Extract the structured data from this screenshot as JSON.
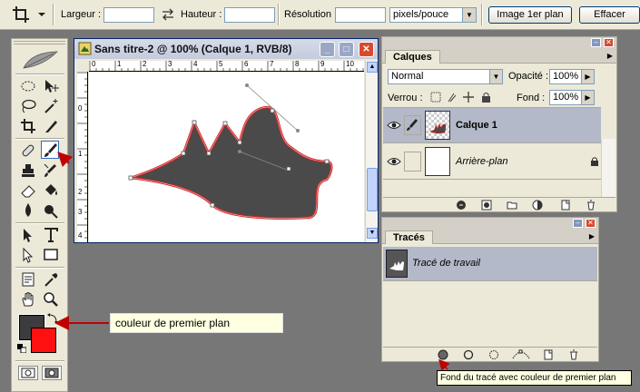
{
  "options_bar": {
    "width_label": "Largeur :",
    "width_value": "",
    "height_label": "Hauteur :",
    "height_value": "",
    "resolution_label": "Résolution :",
    "resolution_value": "",
    "resolution_unit": "pixels/pouce",
    "front_image_button": "Image 1er plan",
    "clear_button": "Effacer"
  },
  "document": {
    "title": "Sans titre-2 @ 100% (Calque 1, RVB/8)",
    "ruler_h": [
      "0",
      "1",
      "2",
      "3",
      "4",
      "5",
      "6",
      "7",
      "8",
      "9",
      "10"
    ],
    "ruler_v": [
      "0",
      "1",
      "2",
      "3",
      "4"
    ]
  },
  "layers_panel": {
    "tab": "Calques",
    "blend_mode": "Normal",
    "opacity_label": "Opacité :",
    "opacity_value": "100%",
    "lock_label": "Verrou :",
    "fill_label": "Fond :",
    "fill_value": "100%",
    "layers": [
      {
        "name": "Calque 1",
        "selected": true
      },
      {
        "name": "Arrière-plan",
        "selected": false
      }
    ]
  },
  "paths_panel": {
    "tab": "Tracés",
    "paths": [
      {
        "name": "Tracé de travail",
        "selected": true
      }
    ]
  },
  "annotations": {
    "foreground_color": "couleur de premier plan",
    "fill_path_tooltip": "Fond du tracé avec couleur de premier plan"
  },
  "colors": {
    "foreground": "#3c3c3c",
    "background": "#ff1010",
    "shape_fill": "#4a4a4a",
    "path_stroke": "#e31b1b",
    "arrow": "#c00000"
  },
  "icons": [
    "crop-icon",
    "swap-arrows-icon",
    "feather-icon",
    "marquee-icon",
    "move-icon",
    "lasso-icon",
    "magic-wand-icon",
    "crop-tool-icon",
    "slice-icon",
    "healing-icon",
    "brush-icon",
    "stamp-icon",
    "history-brush-icon",
    "eraser-icon",
    "bucket-icon",
    "blur-icon",
    "dodge-icon",
    "path-select-icon",
    "type-icon",
    "direct-select-icon",
    "shape-icon",
    "notes-icon",
    "eyedropper-icon",
    "hand-icon",
    "zoom-icon",
    "eye-icon",
    "lock-icon",
    "trash-icon"
  ]
}
